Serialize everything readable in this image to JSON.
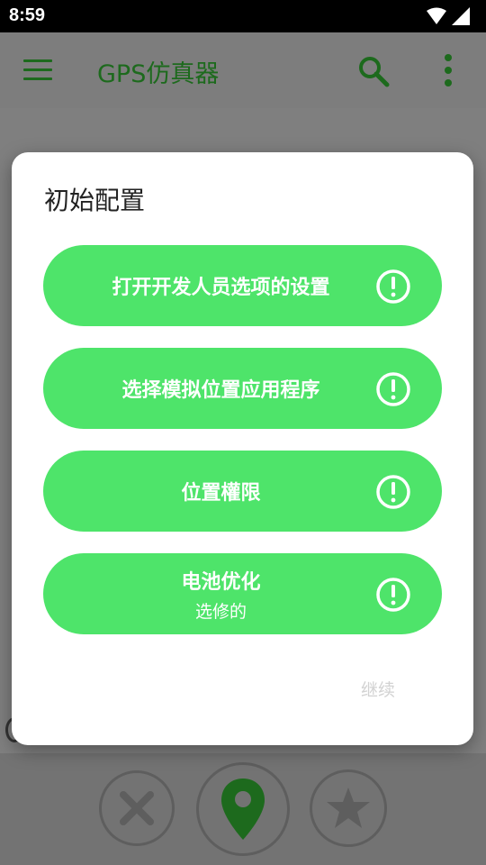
{
  "status_bar": {
    "time": "8:59"
  },
  "app_bar": {
    "title": "GPS仿真器"
  },
  "dialog": {
    "title": "初始配置",
    "options": [
      {
        "label": "打开开发人员选项的设置",
        "sublabel": ""
      },
      {
        "label": "选择模拟位置应用程序",
        "sublabel": ""
      },
      {
        "label": "位置權限",
        "sublabel": ""
      },
      {
        "label": "电池优化",
        "sublabel": "选修的"
      }
    ],
    "continue_label": "继续"
  },
  "colors": {
    "accent_green": "#4ee46a",
    "app_green": "#1d6a1d",
    "scrim": "#7f7f7f"
  },
  "icons": {
    "option_status": "alert-circle-icon",
    "menu": "menu-icon",
    "search": "search-icon",
    "more": "more-vert-icon"
  }
}
